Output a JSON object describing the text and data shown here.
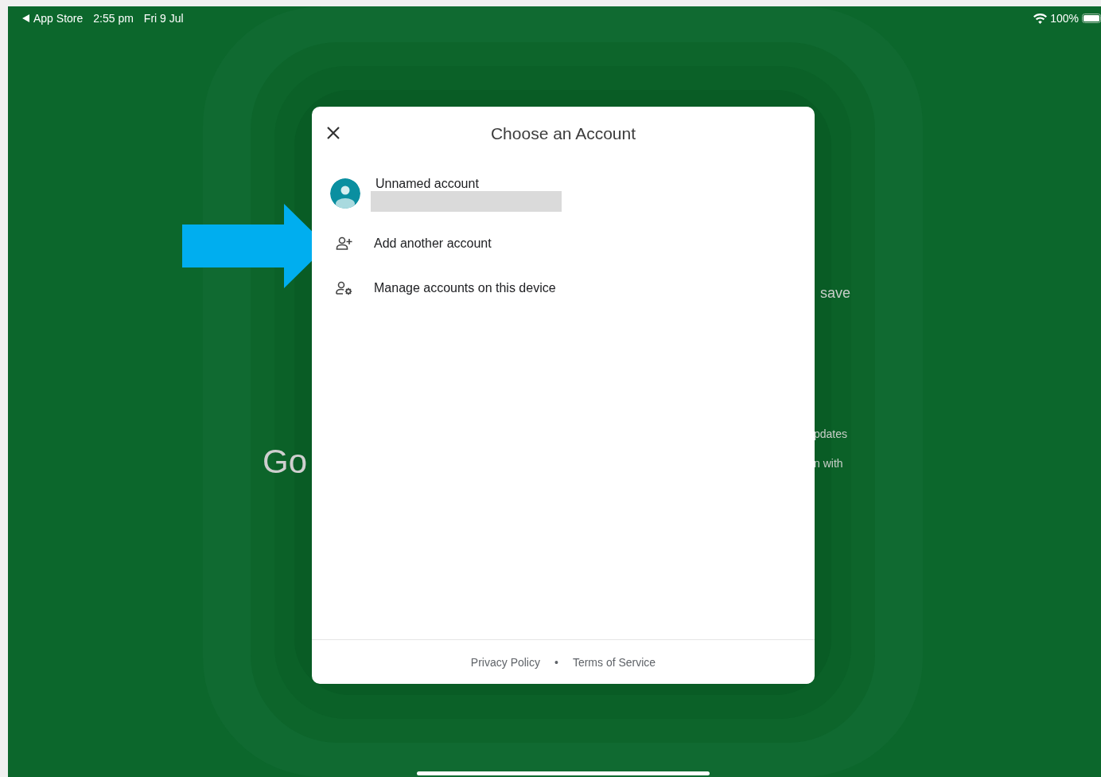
{
  "status_bar": {
    "back_label": "App Store",
    "time": "2:55 pm",
    "date": "Fri 9 Jul",
    "battery": "100%"
  },
  "background_texts": [
    {
      "text": "Go",
      "kind": "logo"
    },
    {
      "text": "save",
      "kind": "large"
    },
    {
      "text": "pdates",
      "kind": "small"
    },
    {
      "text": "n with",
      "kind": "small"
    }
  ],
  "dialog": {
    "title": "Choose an Account",
    "accounts": [
      {
        "name": "Unnamed account"
      }
    ],
    "actions": [
      {
        "label": "Add another account",
        "kind": "add"
      },
      {
        "label": "Manage accounts on this device",
        "kind": "manage"
      }
    ],
    "footer_links": [
      "Privacy Policy",
      "Terms of Service"
    ],
    "separator": "•"
  }
}
